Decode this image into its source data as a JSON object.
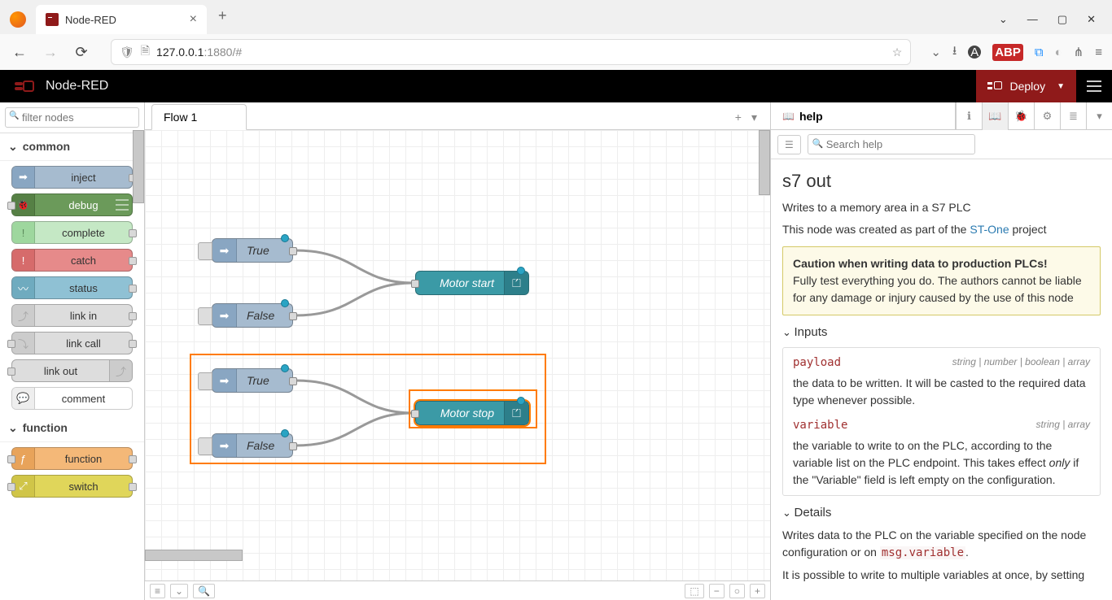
{
  "browser": {
    "tab_title": "Node-RED",
    "url": "127.0.0.1:1880/#",
    "url_tail": "1880/#"
  },
  "header": {
    "title": "Node-RED",
    "deploy": "Deploy"
  },
  "palette": {
    "filter_placeholder": "filter nodes",
    "cat_common": "common",
    "cat_function": "function",
    "nodes": {
      "inject": "inject",
      "debug": "debug",
      "complete": "complete",
      "catch": "catch",
      "status": "status",
      "link_in": "link in",
      "link_call": "link call",
      "link_out": "link out",
      "comment": "comment",
      "function": "function",
      "switch": "switch"
    }
  },
  "workspace": {
    "tab": "Flow 1",
    "nodes": {
      "true1": "True",
      "false1": "False",
      "motor_start": "Motor start",
      "true2": "True",
      "false2": "False",
      "motor_stop": "Motor stop"
    }
  },
  "sidebar": {
    "tab": "help",
    "search_placeholder": "Search help",
    "title": "s7 out",
    "p1": "Writes to a memory area in a S7 PLC",
    "p2a": "This node was created as part of the ",
    "p2_link": "ST-One",
    "p2b": " project",
    "caution_title": "Caution when writing data to production PLCs!",
    "caution_body": "Fully test everything you do. The authors cannot be liable for any damage or injury caused by the use of this node",
    "inputs_header": "Inputs",
    "payload_key": "payload",
    "payload_types": "string | number | boolean | array",
    "payload_desc": "the data to be written. It will be casted to the required data type whenever possible.",
    "variable_key": "variable",
    "variable_types": "string | array",
    "variable_desc_a": "the variable to write to on the PLC, according to the variable list on the PLC endpoint. This takes effect ",
    "variable_desc_only": "only",
    "variable_desc_b": " if the \"Variable\" field is left empty on the configuration.",
    "details_header": "Details",
    "details_p1a": "Writes data to the PLC on the variable specified on the node configuration or on ",
    "details_code": "msg.variable",
    "details_p1b": ".",
    "details_p2": "It is possible to write to multiple variables at once, by setting"
  }
}
